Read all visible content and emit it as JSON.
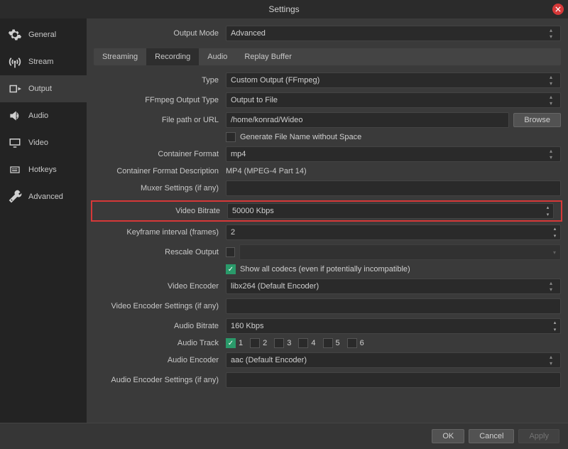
{
  "window": {
    "title": "Settings"
  },
  "sidebar": {
    "items": [
      {
        "label": "General"
      },
      {
        "label": "Stream"
      },
      {
        "label": "Output"
      },
      {
        "label": "Audio"
      },
      {
        "label": "Video"
      },
      {
        "label": "Hotkeys"
      },
      {
        "label": "Advanced"
      }
    ]
  },
  "topRow": {
    "label": "Output Mode",
    "value": "Advanced"
  },
  "tabs": [
    {
      "label": "Streaming"
    },
    {
      "label": "Recording"
    },
    {
      "label": "Audio"
    },
    {
      "label": "Replay Buffer"
    }
  ],
  "fields": {
    "type": {
      "label": "Type",
      "value": "Custom Output (FFmpeg)"
    },
    "ffmpegType": {
      "label": "FFmpeg Output Type",
      "value": "Output to File"
    },
    "filePath": {
      "label": "File path or URL",
      "value": "/home/konrad/Wideo",
      "browse": "Browse"
    },
    "genFileName": {
      "label": "Generate File Name without Space",
      "checked": false
    },
    "containerFormat": {
      "label": "Container Format",
      "value": "mp4"
    },
    "containerDesc": {
      "label": "Container Format Description",
      "value": "MP4 (MPEG-4 Part 14)"
    },
    "muxer": {
      "label": "Muxer Settings (if any)",
      "value": ""
    },
    "videoBitrate": {
      "label": "Video Bitrate",
      "value": "50000 Kbps"
    },
    "keyframe": {
      "label": "Keyframe interval (frames)",
      "value": "2"
    },
    "rescale": {
      "label": "Rescale Output",
      "checked": false,
      "placeholder": ""
    },
    "showAllCodecs": {
      "label": "Show all codecs (even if potentially incompatible)",
      "checked": true
    },
    "videoEncoder": {
      "label": "Video Encoder",
      "value": "libx264 (Default Encoder)"
    },
    "videoEncSettings": {
      "label": "Video Encoder Settings (if any)",
      "value": ""
    },
    "audioBitrate": {
      "label": "Audio Bitrate",
      "value": "160 Kbps"
    },
    "audioTrack": {
      "label": "Audio Track",
      "tracks": [
        "1",
        "2",
        "3",
        "4",
        "5",
        "6"
      ],
      "checked": [
        true,
        false,
        false,
        false,
        false,
        false
      ]
    },
    "audioEncoder": {
      "label": "Audio Encoder",
      "value": "aac (Default Encoder)"
    },
    "audioEncSettings": {
      "label": "Audio Encoder Settings (if any)",
      "value": ""
    }
  },
  "footer": {
    "ok": "OK",
    "cancel": "Cancel",
    "apply": "Apply"
  }
}
